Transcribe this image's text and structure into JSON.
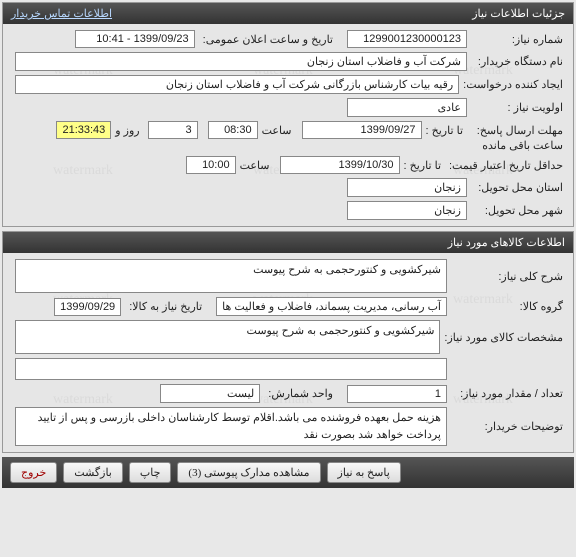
{
  "panel1": {
    "title": "جزئیات اطلاعات نیاز",
    "contact_link": "اطلاعات تماس خریدار",
    "rows": {
      "need_no_label": "شماره نیاز:",
      "need_no": "1299001230000123",
      "announce_label": "تاریخ و ساعت اعلان عمومی:",
      "announce_val": "1399/09/23 - 10:41",
      "buyer_label": "نام دستگاه خریدار:",
      "buyer_val": "شرکت آب و فاضلاب استان زنجان",
      "creator_label": "ایجاد کننده درخواست:",
      "creator_val": "رقیه بیات کارشناس بازرگانی شرکت آب و فاضلاب استان زنجان",
      "priority_label": "اولویت نیاز :",
      "priority_val": "عادی",
      "deadline_label": "مهلت ارسال پاسخ:",
      "until_label": "تا تاریخ :",
      "deadline_date": "1399/09/27",
      "time_label": "ساعت",
      "deadline_time": "08:30",
      "days_val": "3",
      "days_label": "روز و",
      "remain_time": "21:33:43",
      "remain_label": "ساعت باقی مانده",
      "min_valid_label": "حداقل تاریخ اعتبار قیمت:",
      "until_label2": "تا تاریخ :",
      "min_valid_date": "1399/10/30",
      "min_valid_time": "10:00",
      "province_label": "استان محل تحویل:",
      "province_val": "زنجان",
      "city_label": "شهر محل تحویل:",
      "city_val": "زنجان"
    }
  },
  "panel2": {
    "title": "اطلاعات کالاهای مورد نیاز",
    "rows": {
      "desc_label": "شرح کلی نیاز:",
      "desc_val": "شیرکشویی و کنتورحجمی  به شرح پیوست",
      "group_label": "گروه کالا:",
      "group_val": "آب رسانی، مدیریت پسماند، فاضلاب و فعالیت ها",
      "date_to_label": "تاریخ نیاز به کالا:",
      "date_to_val": "1399/09/29",
      "spec_label": "مشخصات کالای مورد نیاز:",
      "spec_val": "شیرکشویی و کنتورحجمی  به شرح پیوست",
      "qty_label": "تعداد / مقدار مورد نیاز:",
      "qty_val": "1",
      "unit_label": "واحد شمارش:",
      "unit_val": "لیست",
      "notes_label": "توضیحات خریدار:",
      "notes_val": "هزینه حمل بعهده فروشنده می باشد.اقلام توسط کارشناسان داخلی بازرسی و پس از تایید پرداخت خواهد شد بصورت نقد"
    }
  },
  "footer": {
    "reply": "پاسخ به نیاز",
    "attach": "مشاهده مدارک پیوستی (3)",
    "print": "چاپ",
    "back": "بازگشت",
    "exit": "خروج"
  }
}
